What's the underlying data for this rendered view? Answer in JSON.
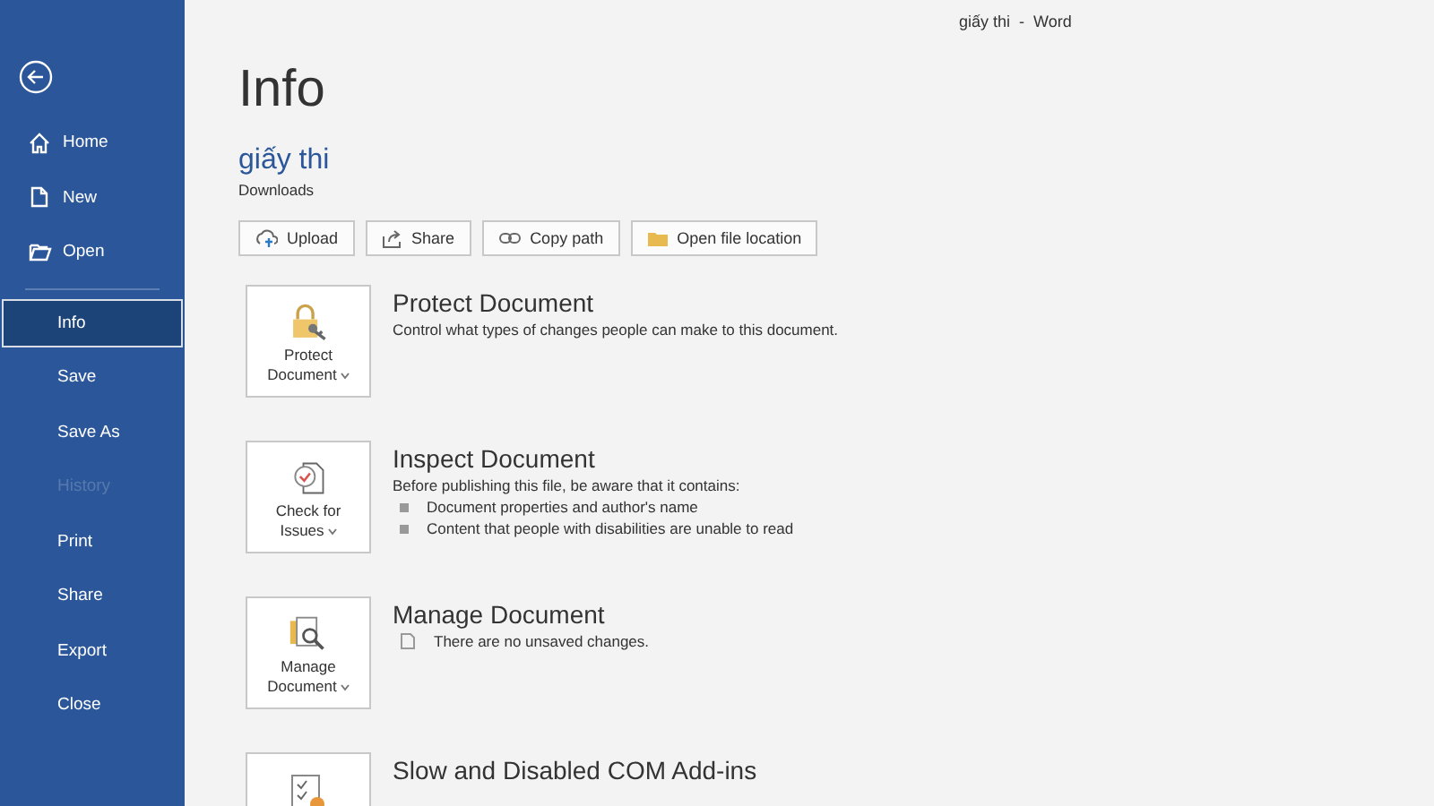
{
  "window": {
    "title": "giấy thi  -  Word"
  },
  "sidebar": {
    "items": [
      {
        "label": "Home",
        "kind": "home",
        "selected": false,
        "disabled": false
      },
      {
        "label": "New",
        "kind": "new",
        "selected": false,
        "disabled": false
      },
      {
        "label": "Open",
        "kind": "open",
        "selected": false,
        "disabled": false
      },
      {
        "label": "Info",
        "kind": "plain",
        "selected": true,
        "disabled": false
      },
      {
        "label": "Save",
        "kind": "plain",
        "selected": false,
        "disabled": false
      },
      {
        "label": "Save As",
        "kind": "plain",
        "selected": false,
        "disabled": false
      },
      {
        "label": "History",
        "kind": "plain",
        "selected": false,
        "disabled": true
      },
      {
        "label": "Print",
        "kind": "plain",
        "selected": false,
        "disabled": false
      },
      {
        "label": "Share",
        "kind": "plain",
        "selected": false,
        "disabled": false
      },
      {
        "label": "Export",
        "kind": "plain",
        "selected": false,
        "disabled": false
      },
      {
        "label": "Close",
        "kind": "plain",
        "selected": false,
        "disabled": false
      }
    ]
  },
  "page": {
    "title": "Info",
    "document_name": "giấy thi",
    "location": "Downloads"
  },
  "actions": [
    {
      "label": "Upload",
      "kind": "upload"
    },
    {
      "label": "Share",
      "kind": "share"
    },
    {
      "label": "Copy path",
      "kind": "link"
    },
    {
      "label": "Open file location",
      "kind": "folder"
    }
  ],
  "sections": [
    {
      "kind": "lock",
      "button": "Protect Document",
      "title": "Protect Document",
      "description": "Control what types of changes people can make to this document."
    },
    {
      "kind": "inspect",
      "button": "Check for Issues",
      "title": "Inspect Document",
      "description": "Before publishing this file, be aware that it contains:",
      "bullets": [
        "Document properties and author's name",
        "Content that people with disabilities are unable to read"
      ]
    },
    {
      "kind": "manage",
      "button": "Manage Document",
      "title": "Manage Document",
      "status": "There are no unsaved changes."
    },
    {
      "kind": "addins",
      "title": "Slow and Disabled COM Add-ins"
    }
  ]
}
